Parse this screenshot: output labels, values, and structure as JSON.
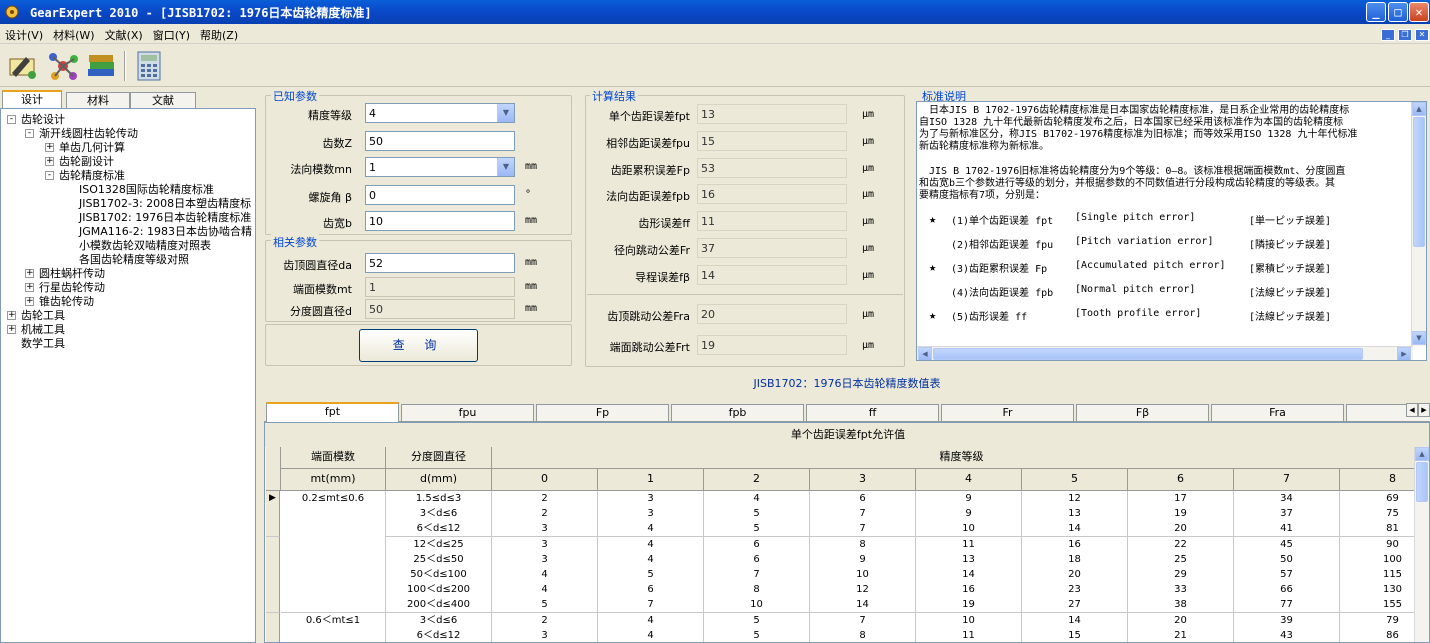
{
  "window": {
    "title": "GearExpert 2010 - [JISB1702: 1976日本齿轮精度标准]",
    "min": "_",
    "max": "□",
    "close": "✕"
  },
  "menu": [
    "设计(V)",
    "材料(W)",
    "文献(X)",
    "窗口(Y)",
    "帮助(Z)"
  ],
  "left_tabs": [
    "设计",
    "材料",
    "文献"
  ],
  "tree": [
    {
      "label": "齿轮设计",
      "level": 0,
      "toggle": "-"
    },
    {
      "label": "渐开线圆柱齿轮传动",
      "level": 1,
      "toggle": "-"
    },
    {
      "label": "单齿几何计算",
      "level": 2,
      "toggle": "+"
    },
    {
      "label": "齿轮副设计",
      "level": 2,
      "toggle": "+"
    },
    {
      "label": "齿轮精度标准",
      "level": 2,
      "toggle": "-"
    },
    {
      "label": "ISO1328国际齿轮精度标准",
      "level": 3,
      "toggle": ""
    },
    {
      "label": "JISB1702-3: 2008日本塑齿精度标",
      "level": 3,
      "toggle": ""
    },
    {
      "label": "JISB1702: 1976日本齿轮精度标准",
      "level": 3,
      "toggle": ""
    },
    {
      "label": "JGMA116-2: 1983日本齿协啮合精",
      "level": 3,
      "toggle": ""
    },
    {
      "label": "小模数齿轮双啮精度对照表",
      "level": 3,
      "toggle": ""
    },
    {
      "label": "各国齿轮精度等级对照",
      "level": 3,
      "toggle": ""
    },
    {
      "label": "圆柱蜗杆传动",
      "level": 1,
      "toggle": "+"
    },
    {
      "label": "行星齿轮传动",
      "level": 1,
      "toggle": "+"
    },
    {
      "label": "锥齿轮传动",
      "level": 1,
      "toggle": "+"
    },
    {
      "label": "齿轮工具",
      "level": 0,
      "toggle": "+"
    },
    {
      "label": "机械工具",
      "level": 0,
      "toggle": "+"
    },
    {
      "label": "数学工具",
      "level": 0,
      "toggle": ""
    }
  ],
  "known": {
    "group": "已知参数",
    "fields": [
      {
        "label": "精度等级",
        "value": "4",
        "type": "select",
        "unit": ""
      },
      {
        "label": "齿数Z",
        "value": "50",
        "type": "input",
        "unit": ""
      },
      {
        "label": "法向模数mn",
        "value": "1",
        "type": "select",
        "unit": "mm"
      },
      {
        "label": "螺旋角 β",
        "value": "0",
        "type": "input",
        "unit": "°"
      },
      {
        "label": "齿宽b",
        "value": "10",
        "type": "input",
        "unit": "mm"
      }
    ]
  },
  "related": {
    "group": "相关参数",
    "fields": [
      {
        "label": "齿顶圆直径da",
        "value": "52",
        "unit": "mm",
        "ro": false
      },
      {
        "label": "端面模数mt",
        "value": "1",
        "unit": "mm",
        "ro": true
      },
      {
        "label": "分度圆直径d",
        "value": "50",
        "unit": "mm",
        "ro": true
      }
    ]
  },
  "query_button": "查 询",
  "results": {
    "group": "计算结果",
    "items": [
      {
        "label": "单个齿距误差fpt",
        "value": "13",
        "unit": "μm"
      },
      {
        "label": "相邻齿距误差fpu",
        "value": "15",
        "unit": "μm"
      },
      {
        "label": "齿距累积误差Fp",
        "value": "53",
        "unit": "μm"
      },
      {
        "label": "法向齿距误差fpb",
        "value": "16",
        "unit": "μm"
      },
      {
        "label": "齿形误差ff",
        "value": "11",
        "unit": "μm"
      },
      {
        "label": "径向跳动公差Fr",
        "value": "37",
        "unit": "μm"
      },
      {
        "label": "导程误差fβ",
        "value": "14",
        "unit": "μm"
      }
    ],
    "items2": [
      {
        "label": "齿顶跳动公差Fra",
        "value": "20",
        "unit": "μm"
      },
      {
        "label": "端面跳动公差Frt",
        "value": "19",
        "unit": "μm"
      }
    ]
  },
  "notes": {
    "group": "标准说明",
    "para1": [
      "　日本JIS B 1702-1976齿轮精度标准是日本国家齿轮精度标准，是日系企业常用的齿轮精度标",
      "自ISO 1328 九十年代最新齿轮精度发布之后，日本国家已经采用该标准作为本国的齿轮精度标",
      "为了与新标准区分，称JIS B1702-1976精度标准为旧标准；而等效采用ISO 1328 九十年代标准",
      "新齿轮精度标准称为新标准。"
    ],
    "para2": [
      "　JIS B 1702-1976旧标准将齿轮精度分为9个等级：0—8。该标准根据端面模数mt、分度圆直",
      "和齿宽b三个参数进行等级的划分，并根据参数的不同数值进行分段构成齿轮精度的等级表。其",
      "要精度指标有7项，分别是："
    ],
    "errors": [
      {
        "star": "★",
        "name": "(1)单个齿距误差  fpt",
        "en": "[Single pitch error]",
        "jp": "[単一ピッチ誤差]"
      },
      {
        "star": "",
        "name": "(2)相邻齿距误差  fpu",
        "en": "[Pitch variation error]",
        "jp": "[隣接ピッチ誤差]"
      },
      {
        "star": "★",
        "name": "(3)齿距累积误差  Fp",
        "en": "[Accumulated pitch error]",
        "jp": "[累積ピッチ誤差]"
      },
      {
        "star": "",
        "name": "(4)法向齿距误差  fpb",
        "en": "[Normal pitch error]",
        "jp": "[法線ピッチ誤差]"
      },
      {
        "star": "★",
        "name": "(5)齿形误差      ff",
        "en": "[Tooth profile error]",
        "jp": "[法線ピッチ誤差]"
      }
    ]
  },
  "table_title": "JISB1702：1976日本齿轮精度数值表",
  "table_tabs": [
    "fpt",
    "fpu",
    "Fp",
    "fpb",
    "ff",
    "Fr",
    "Fβ",
    "Fra",
    ""
  ],
  "grid": {
    "title": "单个齿距误差fpt允许值",
    "h1": [
      "端面模数",
      "分度圆直径",
      "精度等级"
    ],
    "h2": [
      "mt(mm)",
      "d(mm)",
      "0",
      "1",
      "2",
      "3",
      "4",
      "5",
      "6",
      "7",
      "8"
    ],
    "rows": [
      {
        "mt": "0.2≤mt≤0.6",
        "d": "1.5≤d≤3",
        "v": [
          "2",
          "3",
          "4",
          "6",
          "9",
          "12",
          "17",
          "34",
          "69"
        ]
      },
      {
        "mt": "",
        "d": "3＜d≤6",
        "v": [
          "2",
          "3",
          "5",
          "7",
          "9",
          "13",
          "19",
          "37",
          "75"
        ]
      },
      {
        "mt": "",
        "d": "6＜d≤12",
        "v": [
          "3",
          "4",
          "5",
          "7",
          "10",
          "14",
          "20",
          "41",
          "81"
        ]
      },
      {
        "mt": "",
        "d": "12＜d≤25",
        "v": [
          "3",
          "4",
          "6",
          "8",
          "11",
          "16",
          "22",
          "45",
          "90"
        ]
      },
      {
        "mt": "",
        "d": "25＜d≤50",
        "v": [
          "3",
          "4",
          "6",
          "9",
          "13",
          "18",
          "25",
          "50",
          "100"
        ]
      },
      {
        "mt": "",
        "d": "50＜d≤100",
        "v": [
          "4",
          "5",
          "7",
          "10",
          "14",
          "20",
          "29",
          "57",
          "115"
        ]
      },
      {
        "mt": "",
        "d": "100＜d≤200",
        "v": [
          "4",
          "6",
          "8",
          "12",
          "16",
          "23",
          "33",
          "66",
          "130"
        ]
      },
      {
        "mt": "",
        "d": "200＜d≤400",
        "v": [
          "5",
          "7",
          "10",
          "14",
          "19",
          "27",
          "38",
          "77",
          "155"
        ]
      },
      {
        "mt": "0.6＜mt≤1",
        "d": "3＜d≤6",
        "v": [
          "2",
          "4",
          "5",
          "7",
          "10",
          "14",
          "20",
          "39",
          "79"
        ]
      },
      {
        "mt": "",
        "d": "6＜d≤12",
        "v": [
          "3",
          "4",
          "5",
          "8",
          "11",
          "15",
          "21",
          "43",
          "86"
        ]
      }
    ]
  }
}
